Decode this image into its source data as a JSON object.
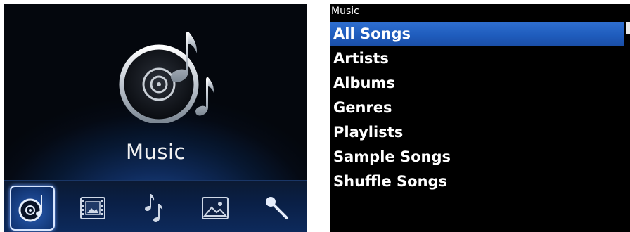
{
  "left": {
    "hero_label": "Music",
    "hero_icon": "music-disc-icon",
    "tray": [
      {
        "icon": "music-icon",
        "selected": true
      },
      {
        "icon": "video-icon",
        "selected": false
      },
      {
        "icon": "ringtone-icon",
        "selected": false
      },
      {
        "icon": "pictures-icon",
        "selected": false
      },
      {
        "icon": "voice-notes-icon",
        "selected": false
      }
    ]
  },
  "right": {
    "title": "Music",
    "items": [
      {
        "label": "All Songs"
      },
      {
        "label": "Artists"
      },
      {
        "label": "Albums"
      },
      {
        "label": "Genres"
      },
      {
        "label": "Playlists"
      },
      {
        "label": "Sample Songs"
      },
      {
        "label": "Shuffle Songs"
      }
    ],
    "selected_index": 0
  },
  "colors": {
    "highlight": "#1f5cbd",
    "panel_background": "#000000",
    "text": "#ffffff"
  }
}
